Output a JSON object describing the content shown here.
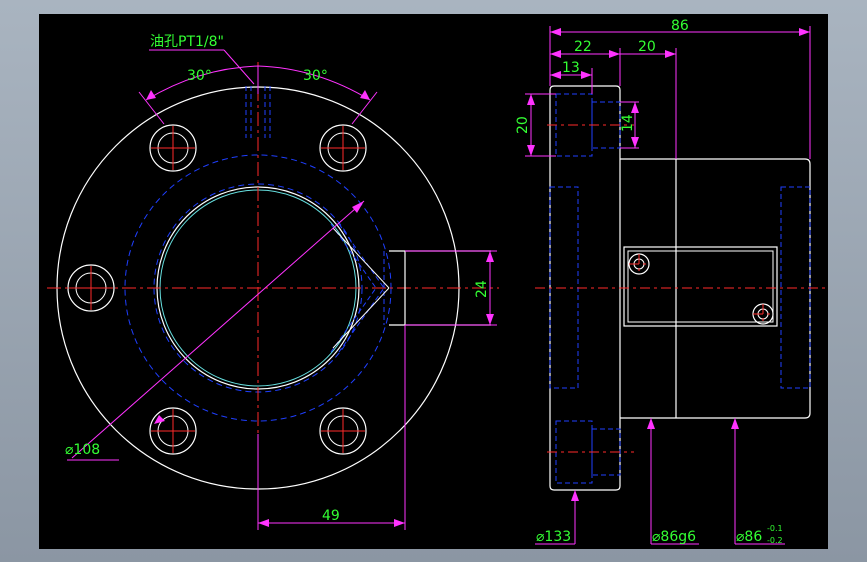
{
  "colors": {
    "background": "#000000",
    "frame": "#a9b4c0",
    "outline": "#ffffff",
    "hidden": "#1f3fff",
    "center": "#ff2a2a",
    "dimension": "#ff33ff",
    "text": "#33ff33",
    "bore_highlight": "#66e0e0"
  },
  "front_view": {
    "oil_hole_label": "油孔PT1/8\"",
    "angle_left": "30°",
    "angle_right": "30°",
    "outer_dia": "⌀108",
    "flat_height": "24",
    "flat_offset": "49"
  },
  "side_view": {
    "total_length": "86",
    "flange_length": "22",
    "body_step": "20",
    "flange_thickness": "13",
    "counterbore_dia": "20",
    "hole_dia": "14",
    "flange_dia": "⌀133",
    "body_dia": "⌀86g6",
    "tol_dia": "⌀86",
    "tol_upper": "-0.1",
    "tol_lower": "-0.2"
  }
}
